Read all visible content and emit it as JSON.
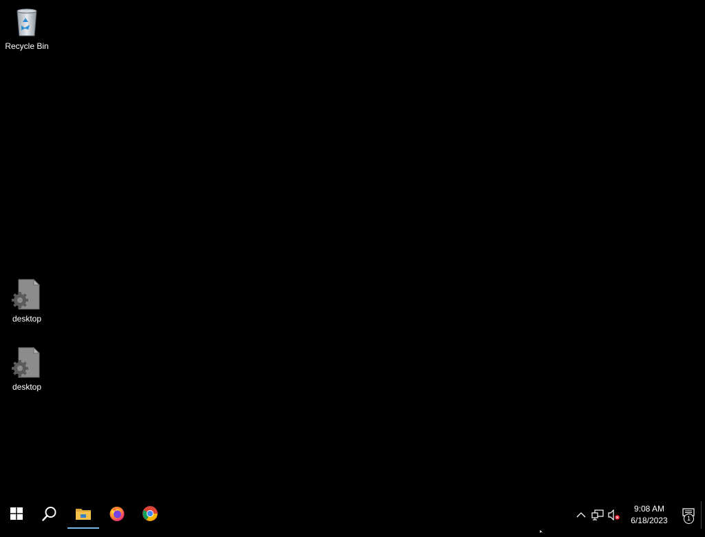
{
  "desktop": {
    "icons": [
      {
        "label": "Recycle Bin",
        "icon": "recycle-bin-icon"
      },
      {
        "label": "desktop",
        "icon": "settings-file-icon"
      },
      {
        "label": "desktop",
        "icon": "settings-file-icon"
      }
    ]
  },
  "taskbar": {
    "start": {
      "icon": "windows-logo-icon"
    },
    "search": {
      "icon": "search-icon"
    },
    "pinned": [
      {
        "app": "File Explorer",
        "icon": "folder-icon",
        "active": true
      },
      {
        "app": "Firefox",
        "icon": "firefox-icon",
        "active": false
      },
      {
        "app": "Chrome",
        "icon": "chrome-icon",
        "active": false
      }
    ],
    "tray": {
      "chevron_icon": "chevron-up-icon",
      "network_icon": "network-icon",
      "volume_icon": "volume-muted-icon",
      "time": "9:08 AM",
      "date": "6/18/2023",
      "notification_count": "1"
    }
  },
  "colors": {
    "background": "#000000",
    "taskbar_active_underline": "#76b9ed",
    "folder_yellow": "#f3c14b",
    "chrome_red": "#db4437",
    "chrome_green": "#0f9d58",
    "chrome_yellow": "#f4b400",
    "chrome_blue": "#4285f4"
  }
}
